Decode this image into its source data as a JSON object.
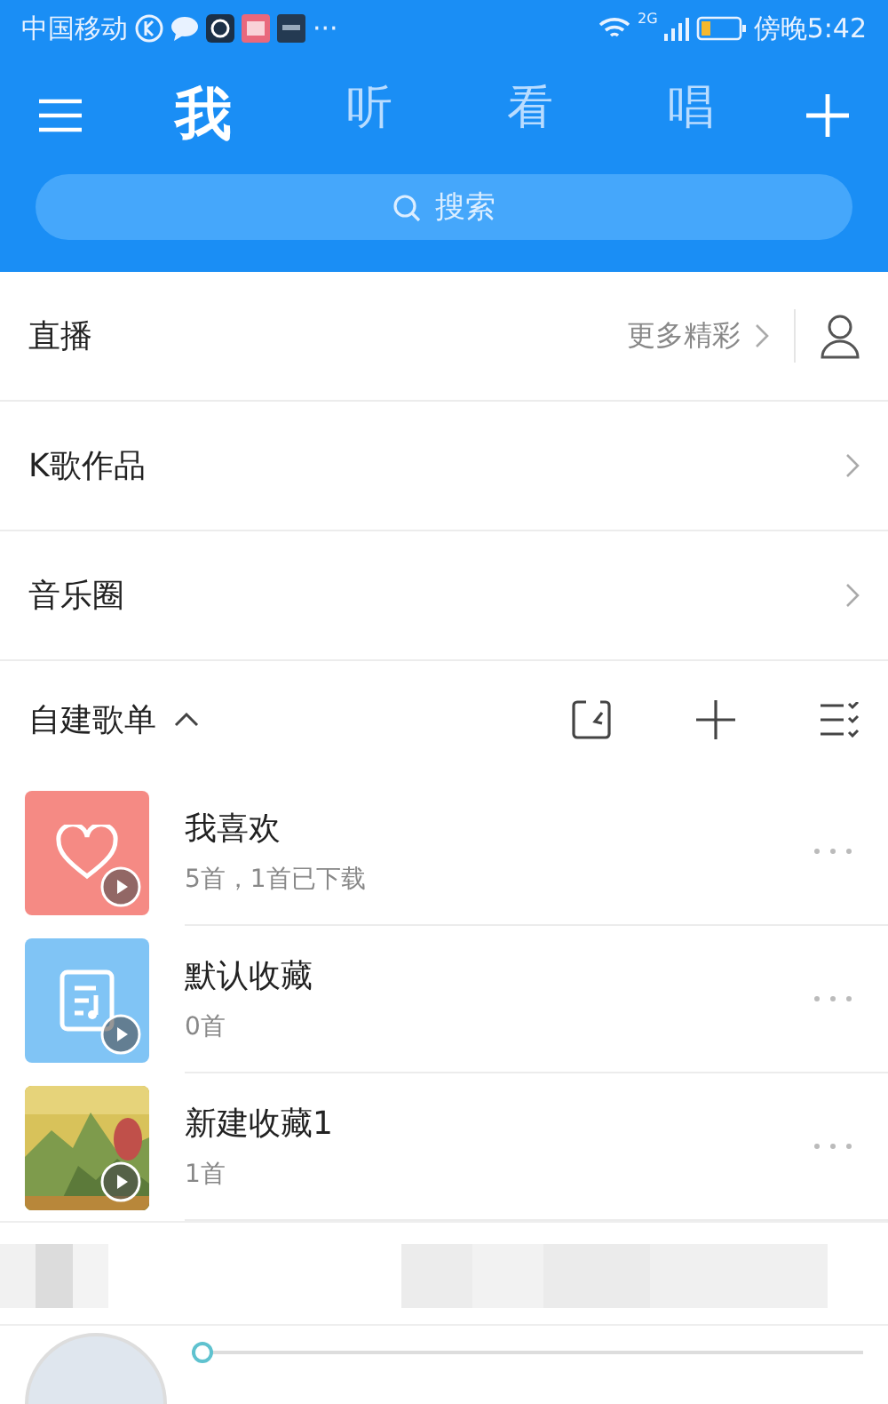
{
  "status_bar": {
    "carrier": "中国移动",
    "network": "2G",
    "time": "傍晚5:42",
    "more": "···"
  },
  "tabs": [
    {
      "label": "我",
      "selected": true
    },
    {
      "label": "听",
      "selected": false
    },
    {
      "label": "看",
      "selected": false
    },
    {
      "label": "唱",
      "selected": false
    }
  ],
  "search": {
    "placeholder": "搜索"
  },
  "sections": [
    {
      "title": "直播",
      "link": "更多精彩",
      "kind": "live"
    },
    {
      "title": "K歌作品",
      "kind": "plain"
    },
    {
      "title": "音乐圈",
      "kind": "plain"
    }
  ],
  "playlist_header": {
    "title": "自建歌单",
    "expanded": true
  },
  "playlists": [
    {
      "name": "我喜欢",
      "info": "5首，1首已下载",
      "kind": "heart"
    },
    {
      "name": "默认收藏",
      "info": "0首",
      "kind": "note"
    },
    {
      "name": "新建收藏1",
      "info": "1首",
      "kind": "picture"
    }
  ],
  "player": {
    "level": 0
  }
}
